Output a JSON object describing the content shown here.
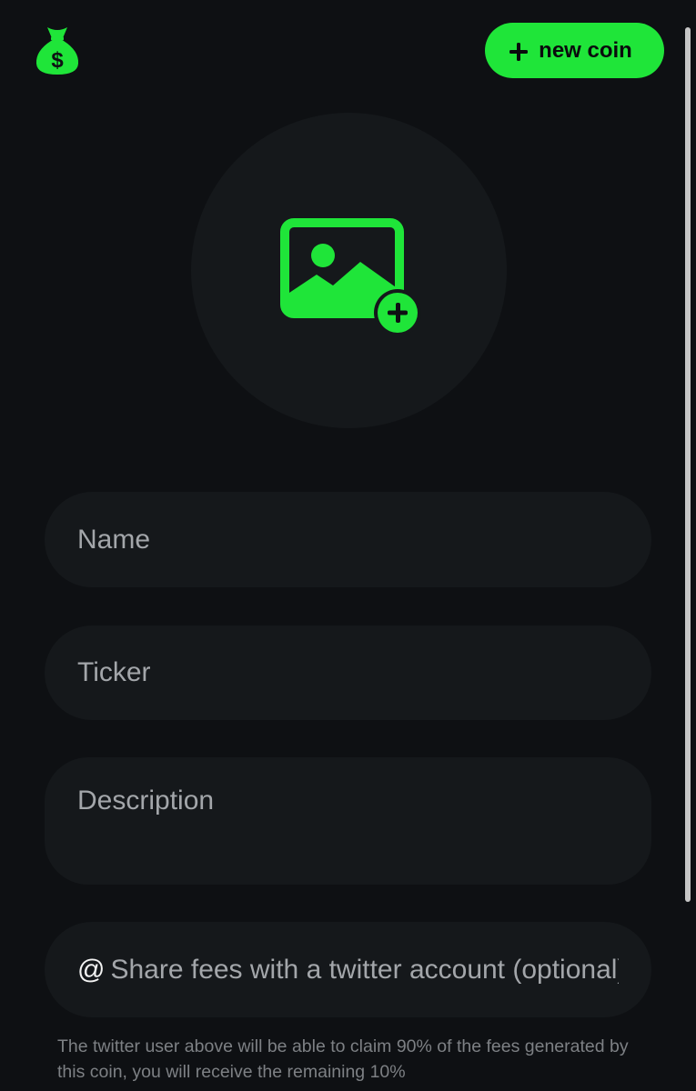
{
  "header": {
    "logo_icon": "money-bag-icon",
    "new_coin_label": "new coin",
    "new_coin_icon": "plus-icon"
  },
  "image_upload": {
    "icon": "add-image-icon"
  },
  "form": {
    "name_placeholder": "Name",
    "name_value": "",
    "ticker_placeholder": "Ticker",
    "ticker_value": "",
    "description_placeholder": "Description",
    "description_value": "",
    "twitter_prefix": "@",
    "twitter_placeholder": "Share fees with a twitter account (optional)",
    "twitter_value": "",
    "twitter_note": "The twitter user above will be able to claim 90% of the fees generated by this coin, you will receive the remaining 10%"
  },
  "colors": {
    "background": "#0e1013",
    "accent": "#1fe539",
    "surface": "#15181b",
    "placeholder": "#a3a6aa",
    "note_text": "#7d8084"
  }
}
